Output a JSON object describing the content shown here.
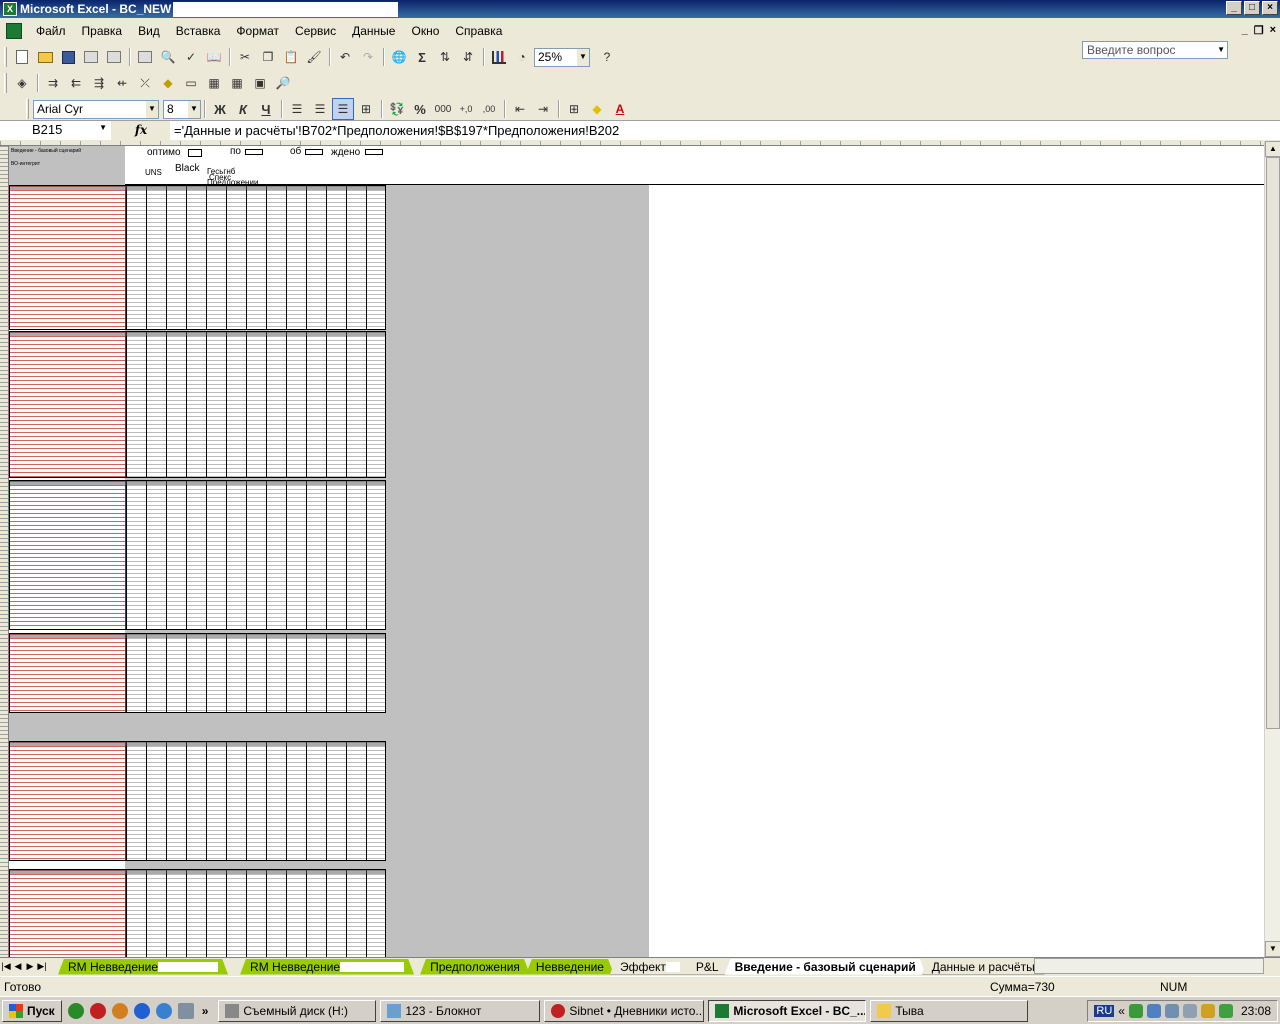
{
  "window": {
    "title": "Microsoft Excel - BC_NEW",
    "controls": [
      "_",
      "□",
      "×"
    ]
  },
  "menu": {
    "items": [
      "Файл",
      "Правка",
      "Вид",
      "Вставка",
      "Формат",
      "Сервис",
      "Данные",
      "Окно",
      "Справка"
    ],
    "help_placeholder": "Введите вопрос"
  },
  "toolbar": {
    "zoom": "25%",
    "font_name": "Arial Cyr",
    "font_size": "8",
    "bold_label": "Ж",
    "italic_label": "К",
    "underline_label": "Ч",
    "percent_label": "%",
    "thousands_label": "000",
    "inc_decimal_label": "+,0",
    "dec_decimal_label": ",00",
    "sum_label": "Σ"
  },
  "formula_bar": {
    "cell_ref": "B215",
    "fx_label": "fx",
    "formula": "='Данные и расчёты'!B702*Предположения!$B$197*Предположения!B202"
  },
  "sheet_header": {
    "title": "Введение - базовый сценарий",
    "subtitle": "ВО-интегрит",
    "labels": [
      "оптимо",
      "по",
      "об",
      "ждено",
      "UNS",
      "Black",
      "Гесьгнб",
      "Спекс",
      "Предложении"
    ]
  },
  "sheet_tabs": [
    {
      "label": "RM Невведение",
      "style": "green",
      "masked": true
    },
    {
      "label": "RM Невведение",
      "style": "green",
      "masked": true
    },
    {
      "label": "Предположения",
      "style": "green",
      "masked": false
    },
    {
      "label": "Невведение",
      "style": "green",
      "masked": false
    },
    {
      "label": "Эффект",
      "style": "plain",
      "masked": true
    },
    {
      "label": "P&L",
      "style": "plain",
      "masked": false
    },
    {
      "label": "Введение - базовый сценарий",
      "style": "active",
      "masked": false
    },
    {
      "label": "Данные и расчёты",
      "style": "plain",
      "masked": false
    }
  ],
  "status": {
    "ready": "Готово",
    "sum": "Сумма=730",
    "num": "NUM"
  },
  "taskbar": {
    "start": "Пуск",
    "quicklaunch_more": "»",
    "tasks": [
      {
        "label": "Съемный диск (H:)",
        "active": false
      },
      {
        "label": "123 - Блокнот",
        "active": false
      },
      {
        "label": "Sibnet • Дневники исто...",
        "active": false
      },
      {
        "label": "Microsoft Excel - BC_...",
        "active": true
      },
      {
        "label": "Тыва",
        "active": false
      }
    ],
    "tray": {
      "lang": "RU",
      "chevron": "«",
      "time": "23:08"
    }
  },
  "colors": {
    "title_bar": "#0a246a",
    "green_tab": "#99cc00",
    "grid_gray": "#c0c0c0"
  }
}
